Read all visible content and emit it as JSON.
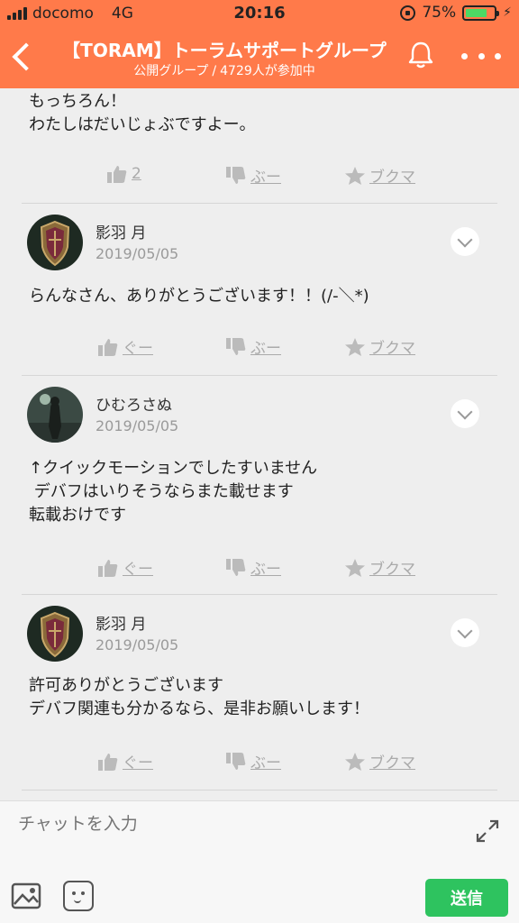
{
  "status_bar": {
    "carrier": "docomo",
    "network": "4G",
    "time": "20:16",
    "battery": "75%",
    "battery_level": 0.75
  },
  "header": {
    "title": "【TORAM】トーラムサポートグループ",
    "subtitle_type": "公開グループ",
    "subtitle_sep": "/",
    "member_count": "4729人が参加中"
  },
  "colors": {
    "brand": "#ff7a4a",
    "send": "#2ec35f",
    "background": "#eeeeee"
  },
  "posts": [
    {
      "body": "もっちろん！\nわたしはだいじょぶですよー。",
      "like": "2",
      "boo": "ぶー",
      "bookmark": "ブクマ"
    },
    {
      "author": "影羽 月",
      "date": "2019/05/05",
      "body": "らんなさん、ありがとうございます！！(/-＼*)",
      "like": "ぐー",
      "boo": "ぶー",
      "bookmark": "ブクマ"
    },
    {
      "author": "ひむろさぬ",
      "date": "2019/05/05",
      "body": "↑クイックモーションでしたすいません\n デバフはいりそうならまた載せます\n転載おけです",
      "like": "ぐー",
      "boo": "ぶー",
      "bookmark": "ブクマ"
    },
    {
      "author": "影羽 月",
      "date": "2019/05/05",
      "body": "許可ありがとうございます\nデバフ関連も分かるなら、是非お願いします！",
      "like": "ぐー",
      "boo": "ぶー",
      "bookmark": "ブクマ"
    }
  ],
  "composer": {
    "placeholder": "チャットを入力",
    "send_label": "送信"
  }
}
